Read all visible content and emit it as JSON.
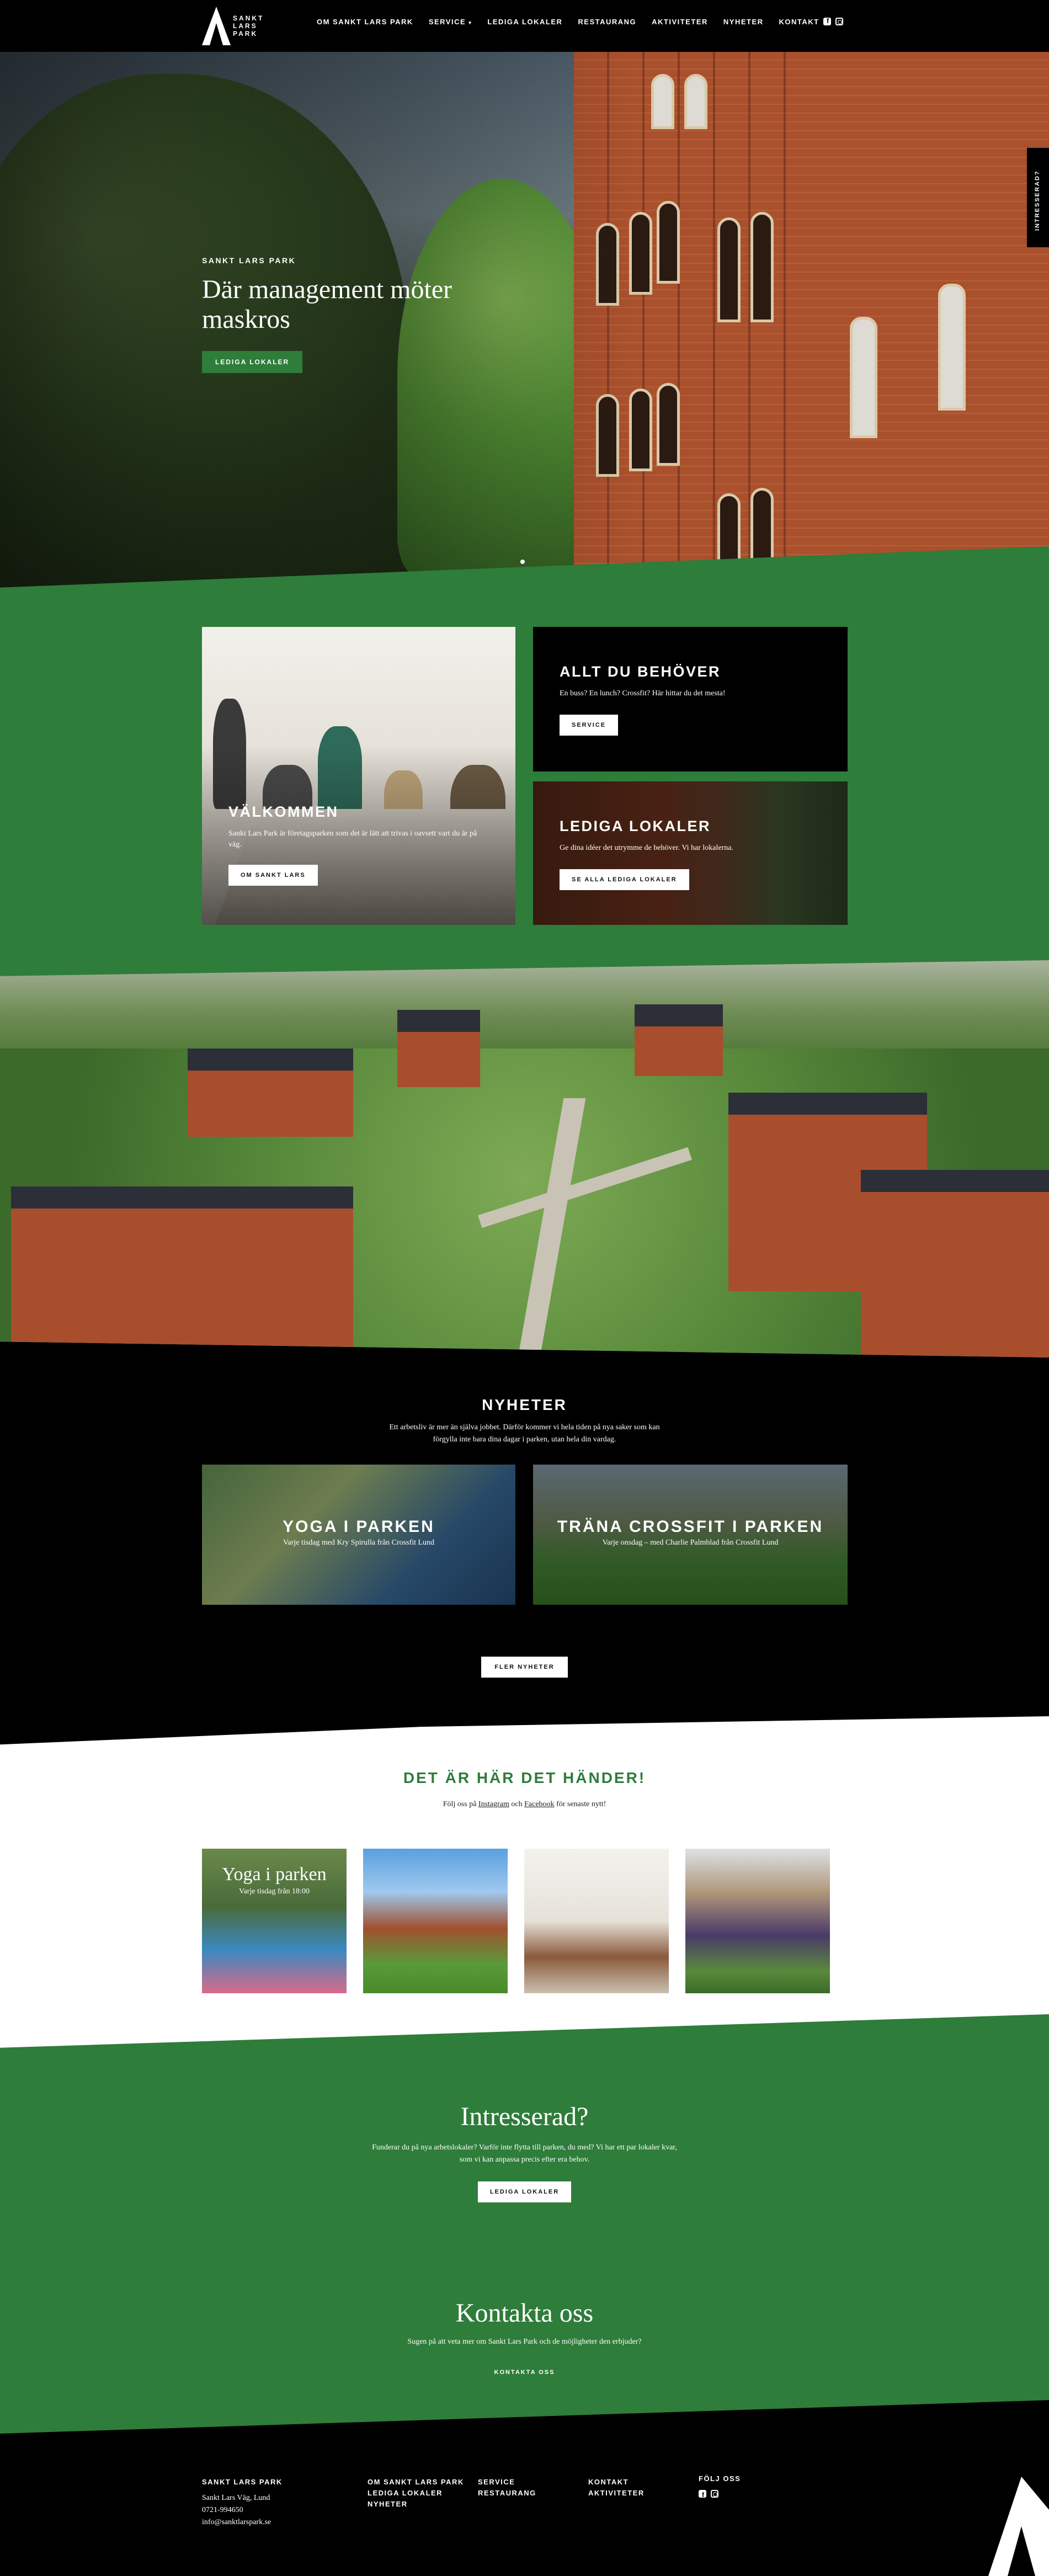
{
  "header": {
    "logo_text": [
      "SANKT",
      "LARS",
      "PARK"
    ],
    "nav": [
      "OM SANKT LARS PARK",
      "SERVICE",
      "LEDIGA LOKALER",
      "RESTAURANG",
      "AKTIVITETER",
      "NYHETER",
      "KONTAKT"
    ],
    "social_icons": [
      "facebook-icon",
      "instagram-icon"
    ]
  },
  "side_tab": "INTRESSERAD?",
  "hero": {
    "eyebrow": "SANKT LARS PARK",
    "title": "Där management möter maskros",
    "button": "LEDIGA LOKALER"
  },
  "cards": {
    "welcome": {
      "title": "VÄLKOMMEN",
      "text": "Sankt Lars Park är företagsparken som det är lätt att trivas i oavsett vart du är på väg.",
      "button": "OM SANKT LARS"
    },
    "allt": {
      "title": "ALLT DU BEHÖVER",
      "text": "En buss? En lunch? Crossfit? Här hittar du det mesta!",
      "button": "SERVICE"
    },
    "lokaler": {
      "title": "LEDIGA LOKALER",
      "text": "Ge dina idéer det utrymme de behöver. Vi har lokalerna.",
      "button": "SE ALLA LEDIGA LOKALER"
    }
  },
  "nyheter": {
    "title": "NYHETER",
    "subtitle": "Ett arbetsliv är mer än själva jobbet. Därför kommer vi hela tiden på nya saker som kan förgylla inte bara dina dagar i parken, utan hela din vardag.",
    "items": [
      {
        "title": "YOGA I PARKEN",
        "subtitle": "Varje tisdag med Kry Spirulla från Crossfit Lund"
      },
      {
        "title": "TRÄNA CROSSFIT I PARKEN",
        "subtitle": "Varje onsdag – med Charlie Palmblad från Crossfit Lund"
      }
    ],
    "button": "FLER NYHETER"
  },
  "social": {
    "title": "DET ÄR HÄR DET HÄNDER!",
    "text_before": "Följ oss på ",
    "instagram": "Instagram",
    "text_mid": " och ",
    "facebook": "Facebook",
    "text_after": " för senaste nytt!",
    "post1_title": "Yoga i parken",
    "post1_sub": "Varje tisdag från 18:00"
  },
  "interested": {
    "title": "Intresserad?",
    "text": "Funderar du på nya arbetslokaler? Varför inte flytta till parken, du med? Vi har ett par lokaler kvar, som vi kan anpassa precis efter era behov.",
    "button": "LEDIGA LOKALER"
  },
  "contact": {
    "title": "Kontakta oss",
    "text": "Sugen på att veta mer om Sankt Lars Park och de möjligheter den erbjuder?",
    "button": "KONTAKTA OSS"
  },
  "footer": {
    "company": "SANKT LARS PARK",
    "address": "Sankt Lars Väg, Lund",
    "phone": "0721-994650",
    "email": "info@sanktlarspark.se",
    "col2": [
      "OM SANKT LARS PARK",
      "LEDIGA LOKALER",
      "NYHETER"
    ],
    "col3": [
      "SERVICE",
      "RESTAURANG"
    ],
    "col4": [
      "KONTAKT",
      "AKTIVITETER"
    ],
    "follow": "FÖLJ OSS"
  },
  "colors": {
    "green": "#2e7d3a",
    "black": "#000000",
    "white": "#ffffff"
  }
}
